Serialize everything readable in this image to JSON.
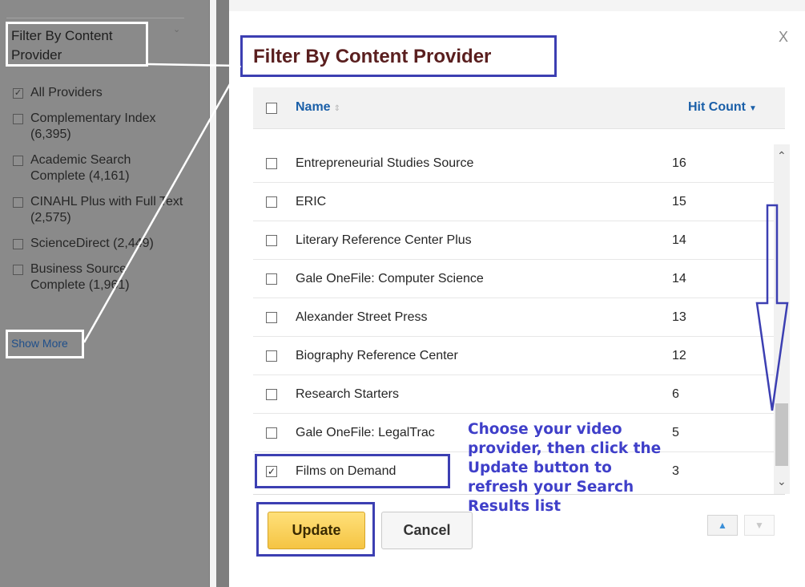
{
  "sidebar": {
    "title": "Filter By Content Provider",
    "items": [
      {
        "label": "All Providers",
        "checked": true
      },
      {
        "label": "Complementary Index (6,395)",
        "checked": false
      },
      {
        "label": "Academic Search Complete (4,161)",
        "checked": false
      },
      {
        "label": "CINAHL Plus with Full Text (2,575)",
        "checked": false
      },
      {
        "label": "ScienceDirect (2,449)",
        "checked": false
      },
      {
        "label": "Business Source Complete (1,961)",
        "checked": false
      }
    ],
    "show_more": "Show More"
  },
  "modal": {
    "title": "Filter By Content Provider",
    "close_label": "X",
    "columns": {
      "name": "Name",
      "hit_count": "Hit Count"
    },
    "rows": [
      {
        "name": "Entrepreneurial Studies Source",
        "count": "16",
        "checked": false
      },
      {
        "name": "ERIC",
        "count": "15",
        "checked": false
      },
      {
        "name": "Literary Reference Center Plus",
        "count": "14",
        "checked": false
      },
      {
        "name": "Gale OneFile: Computer Science",
        "count": "14",
        "checked": false
      },
      {
        "name": "Alexander Street Press",
        "count": "13",
        "checked": false
      },
      {
        "name": "Biography Reference Center",
        "count": "12",
        "checked": false
      },
      {
        "name": "Research Starters",
        "count": "6",
        "checked": false
      },
      {
        "name": "Gale OneFile: LegalTrac",
        "count": "5",
        "checked": false
      },
      {
        "name": "Films on Demand",
        "count": "3",
        "checked": true
      }
    ],
    "buttons": {
      "update": "Update",
      "cancel": "Cancel"
    }
  },
  "annotation": {
    "lines": [
      "Choose your video",
      "provider, then click the",
      "Update button to",
      "refresh your Search",
      "Results list"
    ]
  },
  "colors": {
    "annotation": "#3c3fb2",
    "title": "#5a1f1f",
    "link": "#1a5fa8",
    "update_button": "#f5c443"
  }
}
